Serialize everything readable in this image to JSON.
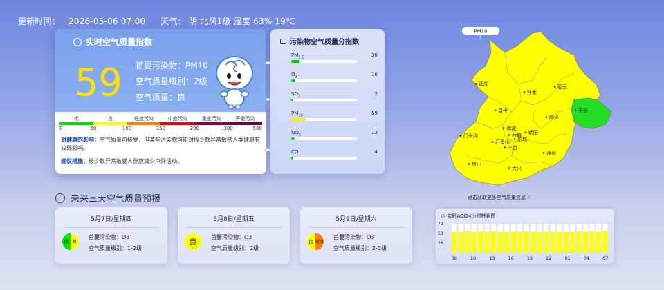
{
  "header": {
    "update_label": "更新时间：",
    "update_time": "2026-05-06 07:00",
    "weather_label": "天气:",
    "weather": "阴 北风1级 湿度 63% 19℃"
  },
  "realtime": {
    "title": "实时空气质量指数",
    "aqi": "59",
    "primary": "首要污染物：PM10",
    "level": "空气质量级别：2级",
    "quality": "空气质量：良",
    "scale_labels": [
      "优",
      "良",
      "轻度污染",
      "中度污染",
      "重度污染",
      "严重污染"
    ],
    "scale_colors": [
      "#00e400",
      "#ffff00",
      "#ff7e00",
      "#ff0000",
      "#99004c",
      "#7e0023"
    ],
    "scale_nums": [
      "0",
      "50",
      "100",
      "150",
      "200",
      "300",
      "500"
    ],
    "health_label": "对健康的影响：",
    "health_text": "空气质量可接受，但某些污染物可能对极少数异常敏感人群健康有较弱影响。",
    "advice_label": "建议措施：",
    "advice_text": "极少数异常敏感人群应减少户外活动。"
  },
  "pollutants": {
    "title": "污染物空气质量分指数",
    "items": [
      {
        "name": "PM",
        "sub": "2.5",
        "value": "36",
        "fraction": 0.14,
        "color": "#00d400"
      },
      {
        "name": "O",
        "sub": "3",
        "value": "16",
        "fraction": 0.06,
        "color": "#00d400"
      },
      {
        "name": "SO",
        "sub": "2",
        "value": "2",
        "fraction": 0.02,
        "color": "#00d400"
      },
      {
        "name": "PM",
        "sub": "10",
        "value": "59",
        "fraction": 0.22,
        "color": "#f2f200"
      },
      {
        "name": "NO",
        "sub": "2",
        "value": "13",
        "fraction": 0.05,
        "color": "#00d400"
      },
      {
        "name": "CO",
        "sub": "",
        "value": "4",
        "fraction": 0.02,
        "color": "#00d400"
      }
    ]
  },
  "forecast": {
    "title": "未来三天空气质量预报",
    "cards": [
      {
        "date": "5月7日/星期四",
        "badge_a": "优",
        "badge_b": "良",
        "primary": "首要污染物：O3",
        "level": "空气质量级别：1-2级",
        "colors": [
          "#00e400",
          "#ffff00"
        ]
      },
      {
        "date": "5月8日/星期五",
        "badge_a": "良",
        "badge_b": "",
        "primary": "首要污染物：O3",
        "level": "空气质量级别：2级",
        "colors": [
          "#ffff00",
          "#ffff00"
        ]
      },
      {
        "date": "5月9日/星期六",
        "badge_a": "良",
        "badge_b": "轻度",
        "primary": "首要污染物：O3",
        "level": "空气质量级别：2-3级",
        "colors": [
          "#ffff00",
          "#ff7e00"
        ]
      }
    ]
  },
  "map": {
    "badge": "PM10",
    "caption": "点击获取更多空气质量信息",
    "districts": [
      "延庆",
      "密云",
      "怀柔",
      "平谷",
      "昌平",
      "顺义",
      "门头沟",
      "海淀",
      "朝阳",
      "石景山",
      "丰台",
      "东城",
      "西城",
      "房山",
      "大兴",
      "通州"
    ]
  },
  "chart_data": {
    "type": "bar",
    "title": "实时AQI24小时柱状图：",
    "x_ticks": [
      "08",
      "10",
      "13",
      "16",
      "19",
      "22",
      "01",
      "04",
      "07"
    ],
    "y_ticks": [
      "79",
      "53",
      "26"
    ],
    "ylim": [
      0,
      79
    ],
    "values": [
      56,
      57,
      58,
      57,
      58,
      57,
      58,
      56,
      57,
      58,
      57,
      58,
      57,
      56,
      57,
      58,
      57,
      56,
      57,
      58,
      57,
      58,
      57,
      59
    ],
    "colors": [
      "#ffff00"
    ]
  }
}
